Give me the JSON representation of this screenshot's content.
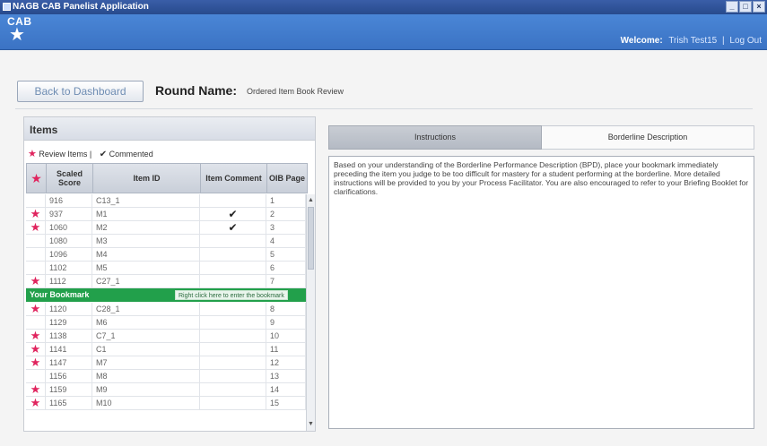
{
  "window": {
    "title": "NAGB CAB Panelist Application"
  },
  "header": {
    "logo_text": "CAB",
    "welcome_label": "Welcome:",
    "user_name": "Trish Test15",
    "separator": "|",
    "logout_label": "Log Out"
  },
  "nav": {
    "back_label": "Back to Dashboard",
    "round_label": "Round Name:",
    "round_value": "Ordered Item Book Review"
  },
  "items_panel": {
    "title": "Items",
    "legend_review": "Review Items |",
    "legend_commented": "Commented",
    "columns": [
      "",
      "Scaled Score",
      "Item ID",
      "Item Comment",
      "OIB Page"
    ],
    "rows_before": [
      {
        "star": false,
        "score": "916",
        "item_id": "C13_1",
        "comment": false,
        "page": "1"
      },
      {
        "star": true,
        "score": "937",
        "item_id": "M1",
        "comment": true,
        "page": "2"
      },
      {
        "star": true,
        "score": "1060",
        "item_id": "M2",
        "comment": true,
        "page": "3"
      },
      {
        "star": false,
        "score": "1080",
        "item_id": "M3",
        "comment": false,
        "page": "4"
      },
      {
        "star": false,
        "score": "1096",
        "item_id": "M4",
        "comment": false,
        "page": "5"
      },
      {
        "star": false,
        "score": "1102",
        "item_id": "M5",
        "comment": false,
        "page": "6"
      },
      {
        "star": true,
        "score": "1112",
        "item_id": "C27_1",
        "comment": false,
        "page": "7"
      }
    ],
    "bookmark": {
      "label": "Your Bookmark",
      "note": "Right click here to enter the bookmark"
    },
    "rows_after": [
      {
        "star": true,
        "score": "1120",
        "item_id": "C28_1",
        "comment": false,
        "page": "8"
      },
      {
        "star": false,
        "score": "1129",
        "item_id": "M6",
        "comment": false,
        "page": "9"
      },
      {
        "star": true,
        "score": "1138",
        "item_id": "C7_1",
        "comment": false,
        "page": "10"
      },
      {
        "star": true,
        "score": "1141",
        "item_id": "C1",
        "comment": false,
        "page": "11"
      },
      {
        "star": true,
        "score": "1147",
        "item_id": "M7",
        "comment": false,
        "page": "12"
      },
      {
        "star": false,
        "score": "1156",
        "item_id": "M8",
        "comment": false,
        "page": "13"
      },
      {
        "star": true,
        "score": "1159",
        "item_id": "M9",
        "comment": false,
        "page": "14"
      },
      {
        "star": true,
        "score": "1165",
        "item_id": "M10",
        "comment": false,
        "page": "15"
      }
    ]
  },
  "tabs": {
    "instructions": "Instructions",
    "borderline": "Borderline Description"
  },
  "instructions_text": "Based on your understanding of the Borderline Performance Description (BPD), place your bookmark immediately preceding the item you judge to be too difficult for mastery for a student performing at the borderline. More detailed instructions will be provided to you by your Process Facilitator. You are also encouraged to refer to your Briefing Booklet for clarifications.",
  "colors": {
    "banner": "#3b73c4",
    "bookmark": "#22a04b",
    "star": "#e0245e"
  }
}
